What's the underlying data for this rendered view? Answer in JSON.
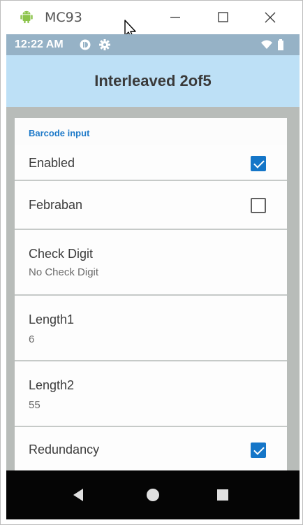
{
  "window": {
    "title": "MC93",
    "icons": {
      "app": "android-icon",
      "minimize": "minimize-icon",
      "maximize": "maximize-icon",
      "close": "close-icon"
    }
  },
  "statusbar": {
    "time": "12:22 AM",
    "icons": [
      "dnd-icon",
      "gear-icon",
      "wifi-icon",
      "battery-icon"
    ]
  },
  "appbar": {
    "title": "Interleaved 2of5"
  },
  "section": {
    "header": "Barcode input"
  },
  "settings": [
    {
      "title": "Enabled",
      "checked": true
    },
    {
      "title": "Febraban",
      "checked": false
    },
    {
      "title": "Check Digit",
      "subtitle": "No Check Digit"
    },
    {
      "title": "Length1",
      "subtitle": "6"
    },
    {
      "title": "Length2",
      "subtitle": "55"
    },
    {
      "title": "Redundancy",
      "checked": true
    }
  ],
  "navbar": {
    "icons": [
      "back-icon",
      "home-icon",
      "recents-icon"
    ]
  },
  "colors": {
    "accent": "#1576c8",
    "appbar": "#bde0f6",
    "statusbar": "#96b2c6",
    "section_header": "#1e7ac9"
  }
}
